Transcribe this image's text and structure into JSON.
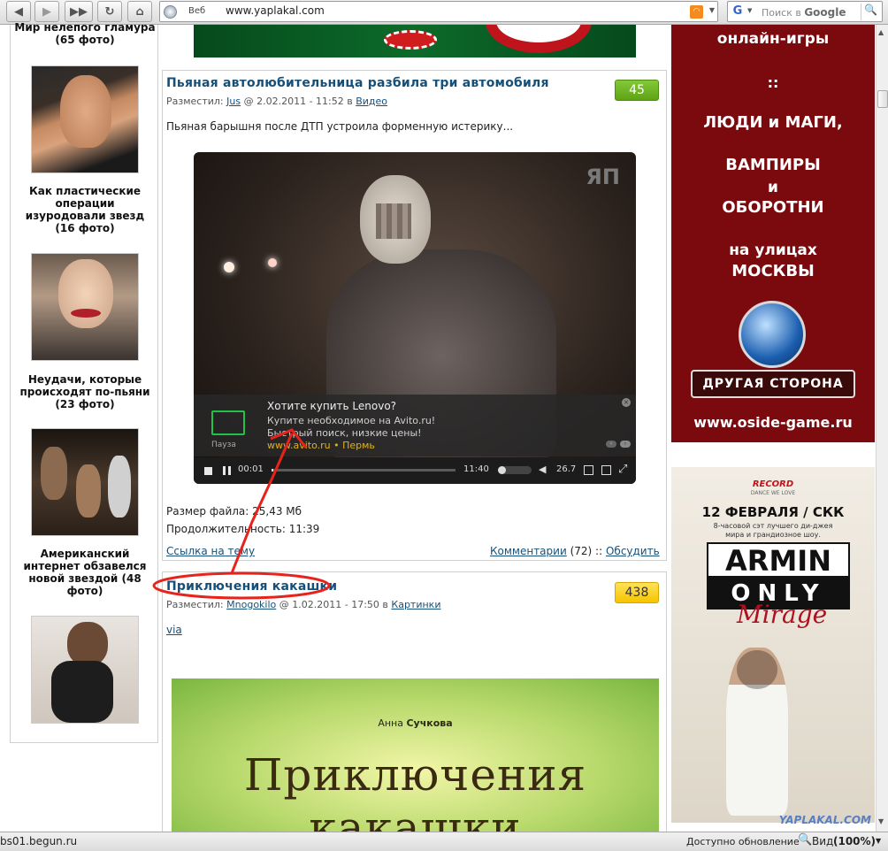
{
  "browser": {
    "url_prefix": "Веб",
    "url": "www.yaplakal.com",
    "rss_label": "RSS",
    "search_engine_icon": "G",
    "search_placeholder_prefix": "Поиск в ",
    "search_placeholder_brand": "Google",
    "status_left": "bs01.begun.ru",
    "status_update": "Доступно обновление",
    "status_zoom_label": "Вид",
    "status_zoom_value": "(100%)"
  },
  "sidebar": {
    "item0_tail": "Мир нелепого гламура (65 фото)",
    "item1": "Как пластические операции изуродовали звезд (16 фото)",
    "item2": "Неудачи, которые происходят по-пьяни (23 фото)",
    "item3": "Американский интернет обзавелся новой звездой (48 фото)"
  },
  "post1": {
    "title": "Пьяная автолюбительница разбила три автомобиля",
    "rating": "45",
    "posted_by_label": "Разместил:",
    "author": "Jus",
    "date": "@ 2.02.2011 - 11:52 в",
    "category": "Видео",
    "lead": "Пьяная барышня после ДТП устроила форменную истерику...",
    "file_size": "Размер файла: 25,43 Мб",
    "duration": "Продолжительность: 11:39",
    "topic_link": "Ссылка на тему",
    "comments_link": "Комментарии",
    "comments_count": "(72) ::",
    "discuss_link": "Обсудить"
  },
  "video": {
    "watermark": "ЯП",
    "ad_title": "Хотите купить Lenovo?",
    "ad_line1": "Купите необходимое на Avito.ru!",
    "ad_line2": "Быстрый поиск, низкие цены!",
    "ad_url": "www.avito.ru",
    "ad_city": "• Пермь",
    "ad_icon_label": "Пауза",
    "time_current": "00:01",
    "time_total": "11:40",
    "bitrate": "26.7",
    "progress": 0.01
  },
  "post2": {
    "title": "Приключения какашки",
    "rating": "438",
    "posted_by_label": "Разместил:",
    "author": "Mnogokilo",
    "date": "@ 1.02.2011 - 17:50 в",
    "category": "Картинки",
    "via": "via",
    "book_author_first": "Анна",
    "book_author_last": "Сучкова",
    "book_title_line1": "Приключения",
    "book_title_line2": "какашки"
  },
  "banner1": {
    "line1": "онлайн-игры",
    "sep": "::",
    "line2": "ЛЮДИ и МАГИ,",
    "line3": "ВАМПИРЫ",
    "line4": "и",
    "line5": "ОБОРОТНИ",
    "line6": "на улицах",
    "line7": "МОСКВЫ",
    "logo_text": "ДРУГАЯ СТОРОНА",
    "url": "www.oside-game.ru"
  },
  "banner2": {
    "brand": "RECORD",
    "brand_sub": "DANCE WE LOVE",
    "date_line": "12 ФЕВРАЛЯ / СКК",
    "desc": "8-часовой сэт лучшего ди-джея мира и грандиозное шоу.",
    "armin": "ARMIN",
    "only": "ONLY",
    "mirage": "Mirage",
    "watermark": "YAPLAKAL.COM"
  },
  "colors": {
    "link": "#15507a",
    "rating_green": "#6db31a",
    "rating_yellow": "#ffd21f",
    "banner_red": "#7a0a0e",
    "annotation_red": "#e8231b"
  }
}
